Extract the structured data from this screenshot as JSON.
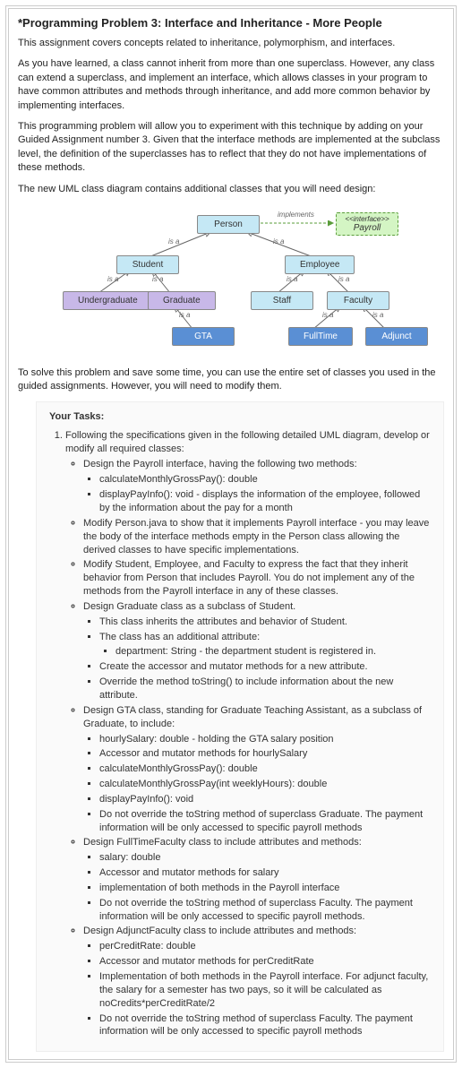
{
  "title": "*Programming Problem 3: Interface and Inheritance - More People",
  "intro": "This assignment covers concepts related to inheritance, polymorphism, and interfaces.",
  "p1": "As you have learned, a class cannot inherit from more than one superclass. However, any class can extend a superclass, and implement an interface, which allows classes in your program to have common attributes and methods through inheritance, and add more common behavior by implementing interfaces.",
  "p2": "This programming problem will allow you to experiment with this technique by adding on your Guided Assignment number 3. Given that the interface methods are implemented at the subclass level, the definition of the superclasses has to reflect that they do not have implementations of these methods.",
  "p3": "The new UML class diagram contains additional classes that you will need design:",
  "diagram": {
    "person": "Person",
    "interface_label": "<<interface>>",
    "payroll": "Payroll",
    "student": "Student",
    "employee": "Employee",
    "undergraduate": "Undergraduate",
    "graduate": "Graduate",
    "staff": "Staff",
    "faculty": "Faculty",
    "gta": "GTA",
    "fulltime": "FullTime",
    "adjunct": "Adjunct",
    "implements": "implements",
    "isa": "is a"
  },
  "p4": "To solve this problem and save some time, you can use the entire set of classes you used in the guided assignments. However, you will need to modify them.",
  "tasks_title": "Your Tasks:",
  "task1": "Following the specifications given in the following detailed UML diagram, develop or modify all required classes:",
  "b1": "Design the Payroll interface, having the following two methods:",
  "b1a": "calculateMonthlyGrossPay(): double",
  "b1b": "displayPayInfo(): void - displays the information of the employee, followed by the information about the pay for a month",
  "b2": "Modify Person.java to show that it implements Payroll interface - you may leave the body of the interface methods empty in the Person class allowing the derived classes to have specific implementations.",
  "b3": "Modify Student, Employee, and Faculty to express the fact that they inherit behavior from Person that includes Payroll. You do not implement any of the methods from the Payroll interface in any of these classes.",
  "b4": "Design Graduate class as a subclass of Student.",
  "b4a": "This class inherits the attributes and behavior of Student.",
  "b4b": "The class has an additional attribute:",
  "b4b1": "department: String - the department student is registered in.",
  "b4c": "Create the accessor and mutator methods for a new attribute.",
  "b4d": "Override the method toString() to include information about the new attribute.",
  "b5": "Design GTA class, standing for Graduate Teaching Assistant, as a subclass of Graduate, to include:",
  "b5a": "hourlySalary: double - holding the GTA salary position",
  "b5b": "Accessor and mutator methods for hourlySalary",
  "b5c": "calculateMonthlyGrossPay(): double",
  "b5d": "calculateMonthlyGrossPay(int weeklyHours): double",
  "b5e": "displayPayInfo(): void",
  "b5f": "Do not override the toString method of superclass Graduate. The payment information will be only accessed to specific payroll methods",
  "b6": "Design FullTimeFaculty class to include attributes and methods:",
  "b6a": "salary: double",
  "b6b": "Accessor and mutator methods for salary",
  "b6c": "implementation of both methods in the Payroll interface",
  "b6d": "Do not override the toString method of superclass Faculty. The payment information will be only accessed to specific payroll methods.",
  "b7": "Design AdjunctFaculty class to include attributes and methods:",
  "b7a": "perCreditRate: double",
  "b7b": "Accessor and mutator methods for perCreditRate",
  "b7c": "Implementation of both methods in the Payroll interface. For adjunct faculty, the salary for a semester has two pays, so it will be calculated as noCredits*perCreditRate/2",
  "b7d": "Do not override the toString method of superclass Faculty. The payment information will be only accessed to specific payroll methods"
}
